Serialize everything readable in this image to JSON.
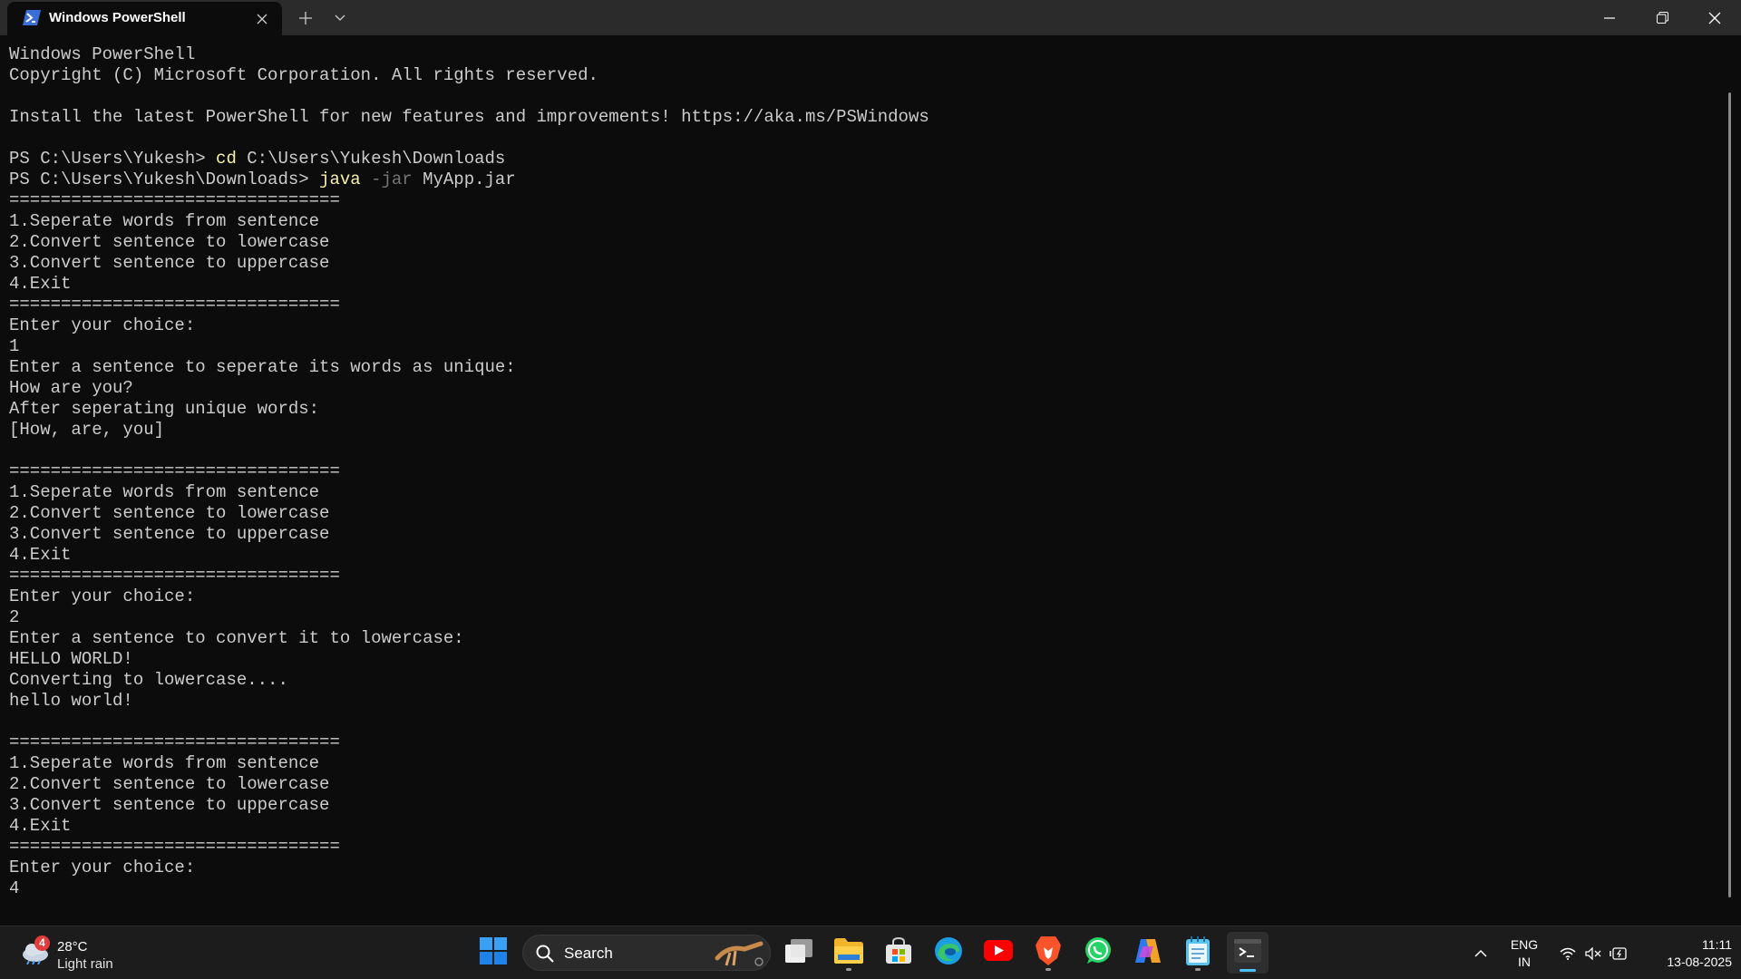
{
  "window": {
    "tab_title": "Windows PowerShell",
    "icons": {
      "tab": "powershell-icon",
      "close_tab": "close-icon",
      "new_tab": "plus-icon",
      "tab_menu": "chevron-down-icon",
      "minimize": "minimize-icon",
      "restore": "restore-icon",
      "close": "close-icon"
    }
  },
  "terminal": {
    "colors": {
      "background": "#0c0c0c",
      "text": "#cccccc",
      "command": "#f9f1a5",
      "parameter": "#767676"
    },
    "lines": [
      {
        "text": "Windows PowerShell"
      },
      {
        "text": "Copyright (C) Microsoft Corporation. All rights reserved."
      },
      {
        "text": ""
      },
      {
        "text": "Install the latest PowerShell for new features and improvements! https://aka.ms/PSWindows"
      },
      {
        "text": ""
      },
      {
        "prompt": "PS C:\\Users\\Yukesh> ",
        "cmd": "cd",
        "rest": " C:\\Users\\Yukesh\\Downloads"
      },
      {
        "prompt": "PS C:\\Users\\Yukesh\\Downloads> ",
        "cmd": "java",
        "param": " -jar",
        "rest": " MyApp.jar"
      },
      {
        "text": "================================"
      },
      {
        "text": "1.Seperate words from sentence"
      },
      {
        "text": "2.Convert sentence to lowercase"
      },
      {
        "text": "3.Convert sentence to uppercase"
      },
      {
        "text": "4.Exit"
      },
      {
        "text": "================================"
      },
      {
        "text": "Enter your choice:"
      },
      {
        "text": "1"
      },
      {
        "text": "Enter a sentence to seperate its words as unique:"
      },
      {
        "text": "How are you?"
      },
      {
        "text": "After seperating unique words:"
      },
      {
        "text": "[How, are, you]"
      },
      {
        "text": ""
      },
      {
        "text": "================================"
      },
      {
        "text": "1.Seperate words from sentence"
      },
      {
        "text": "2.Convert sentence to lowercase"
      },
      {
        "text": "3.Convert sentence to uppercase"
      },
      {
        "text": "4.Exit"
      },
      {
        "text": "================================"
      },
      {
        "text": "Enter your choice:"
      },
      {
        "text": "2"
      },
      {
        "text": "Enter a sentence to convert it to lowercase:"
      },
      {
        "text": "HELLO WORLD!"
      },
      {
        "text": "Converting to lowercase...."
      },
      {
        "text": "hello world!"
      },
      {
        "text": ""
      },
      {
        "text": "================================"
      },
      {
        "text": "1.Seperate words from sentence"
      },
      {
        "text": "2.Convert sentence to lowercase"
      },
      {
        "text": "3.Convert sentence to uppercase"
      },
      {
        "text": "4.Exit"
      },
      {
        "text": "================================"
      },
      {
        "text": "Enter your choice:"
      },
      {
        "text": "4"
      }
    ]
  },
  "taskbar": {
    "weather": {
      "badge": "4",
      "temp": "28°C",
      "desc": "Light rain",
      "icon": "weather-cloud-icon"
    },
    "search": {
      "label": "Search",
      "icon": "search-icon"
    },
    "apps": [
      {
        "name": "start",
        "icon": "windows-start-icon"
      },
      {
        "name": "task-view",
        "icon": "task-view-icon"
      },
      {
        "name": "file-explorer",
        "icon": "folder-icon"
      },
      {
        "name": "microsoft-store",
        "icon": "store-icon"
      },
      {
        "name": "edge",
        "icon": "edge-icon"
      },
      {
        "name": "youtube",
        "icon": "youtube-icon"
      },
      {
        "name": "brave",
        "icon": "brave-icon"
      },
      {
        "name": "whatsapp",
        "icon": "whatsapp-icon"
      },
      {
        "name": "copilot",
        "icon": "copilot-icon"
      },
      {
        "name": "notepad",
        "icon": "notepad-icon"
      },
      {
        "name": "terminal",
        "icon": "terminal-icon"
      }
    ],
    "tray": {
      "lang_line1": "ENG",
      "lang_line2": "IN",
      "time": "11:11",
      "date": "13-08-2025"
    }
  }
}
